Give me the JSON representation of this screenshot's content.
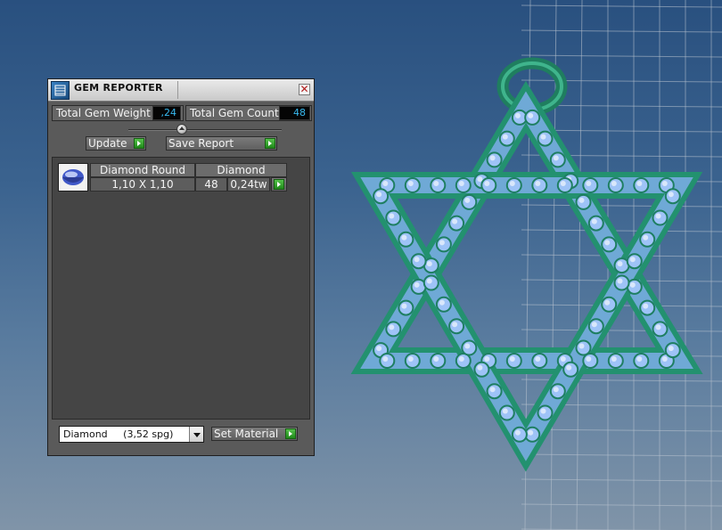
{
  "colors": {
    "accent_value": "#37b9ef",
    "play_green": "#2ea626",
    "pendant_metal": "#23916f",
    "gem_blue": "#9ec3f7"
  },
  "viewport": {
    "object": "star-of-david-pendant",
    "background": "blue-grey-gradient"
  },
  "panel": {
    "title": "GEM REPORTER",
    "close_symbol": "✕",
    "total_weight_label": "Total Gem Weight",
    "total_weight_value": ",24",
    "total_count_label": "Total Gem Count",
    "total_count_value": "48",
    "update_label": "Update",
    "save_report_label": "Save Report",
    "gem_rows": [
      {
        "shape": "Diamond Round",
        "material": "Diamond",
        "size": "1,10 X 1,10",
        "count": "48",
        "weight": "0,24tw"
      }
    ],
    "material_select": "Diamond     (3,52 spg)",
    "set_material_label": "Set Material"
  }
}
